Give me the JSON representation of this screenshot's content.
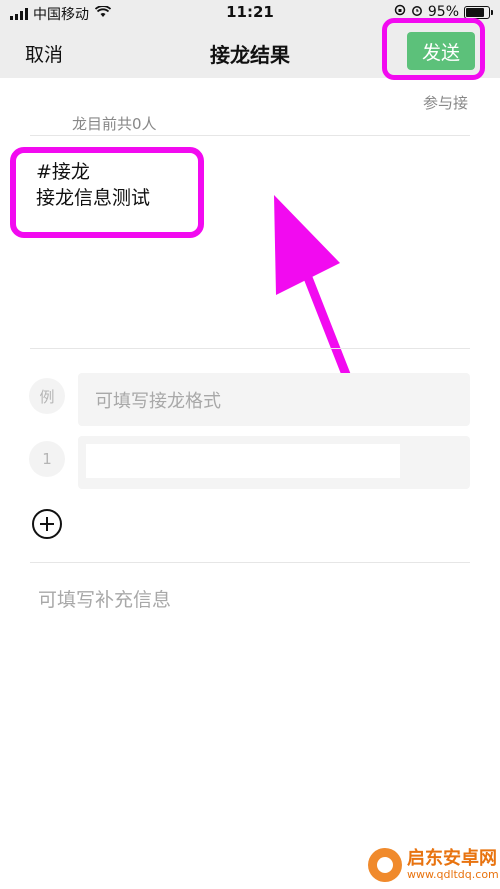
{
  "status_bar": {
    "carrier": "中国移动",
    "time": "11:21",
    "battery": "95%",
    "battery_level": 0.95,
    "icons": [
      "signal-icon",
      "wifi-icon",
      "lock-rotation-icon",
      "alarm-icon",
      "battery-icon"
    ]
  },
  "nav": {
    "cancel_label": "取消",
    "title": "接龙结果",
    "send_label": "发送",
    "send_color": "#5cc17a"
  },
  "participants": {
    "text_line1": "参与接",
    "text_line2": "龙目前共0人"
  },
  "content": {
    "line1": "#接龙",
    "line2": "接龙信息测试"
  },
  "rows": [
    {
      "badge": "例",
      "placeholder": "可填写接龙格式",
      "value": ""
    },
    {
      "badge": "1",
      "placeholder": "",
      "value": ""
    }
  ],
  "supplement_placeholder": "可填写补充信息",
  "annotations": {
    "highlight_color": "#f20af0"
  },
  "watermark": {
    "name": "启东安卓网",
    "url": "www.qdltdq.com"
  }
}
